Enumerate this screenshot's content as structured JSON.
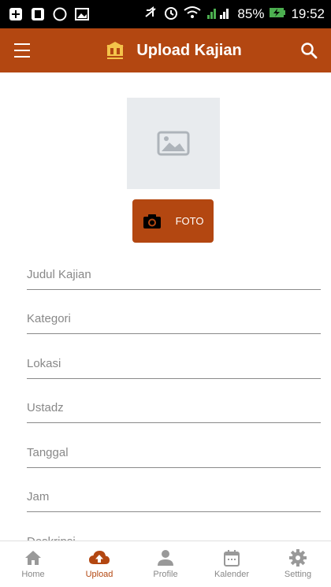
{
  "status": {
    "battery": "85%",
    "time": "19:52"
  },
  "appbar": {
    "title": "Upload Kajian"
  },
  "photo": {
    "button_label": "FOTO"
  },
  "form": {
    "fields": [
      {
        "placeholder": "Judul Kajian"
      },
      {
        "placeholder": "Kategori"
      },
      {
        "placeholder": "Lokasi"
      },
      {
        "placeholder": "Ustadz"
      },
      {
        "placeholder": "Tanggal"
      },
      {
        "placeholder": "Jam"
      },
      {
        "placeholder": "Deskripsi"
      }
    ]
  },
  "nav": {
    "items": [
      {
        "label": "Home",
        "icon": "home-icon"
      },
      {
        "label": "Upload",
        "icon": "cloud-upload-icon"
      },
      {
        "label": "Profile",
        "icon": "person-icon"
      },
      {
        "label": "Kalender",
        "icon": "calendar-icon"
      },
      {
        "label": "Setting",
        "icon": "gear-icon"
      }
    ],
    "active_index": 1
  },
  "colors": {
    "primary": "#b34711",
    "status_bar": "#000000"
  }
}
